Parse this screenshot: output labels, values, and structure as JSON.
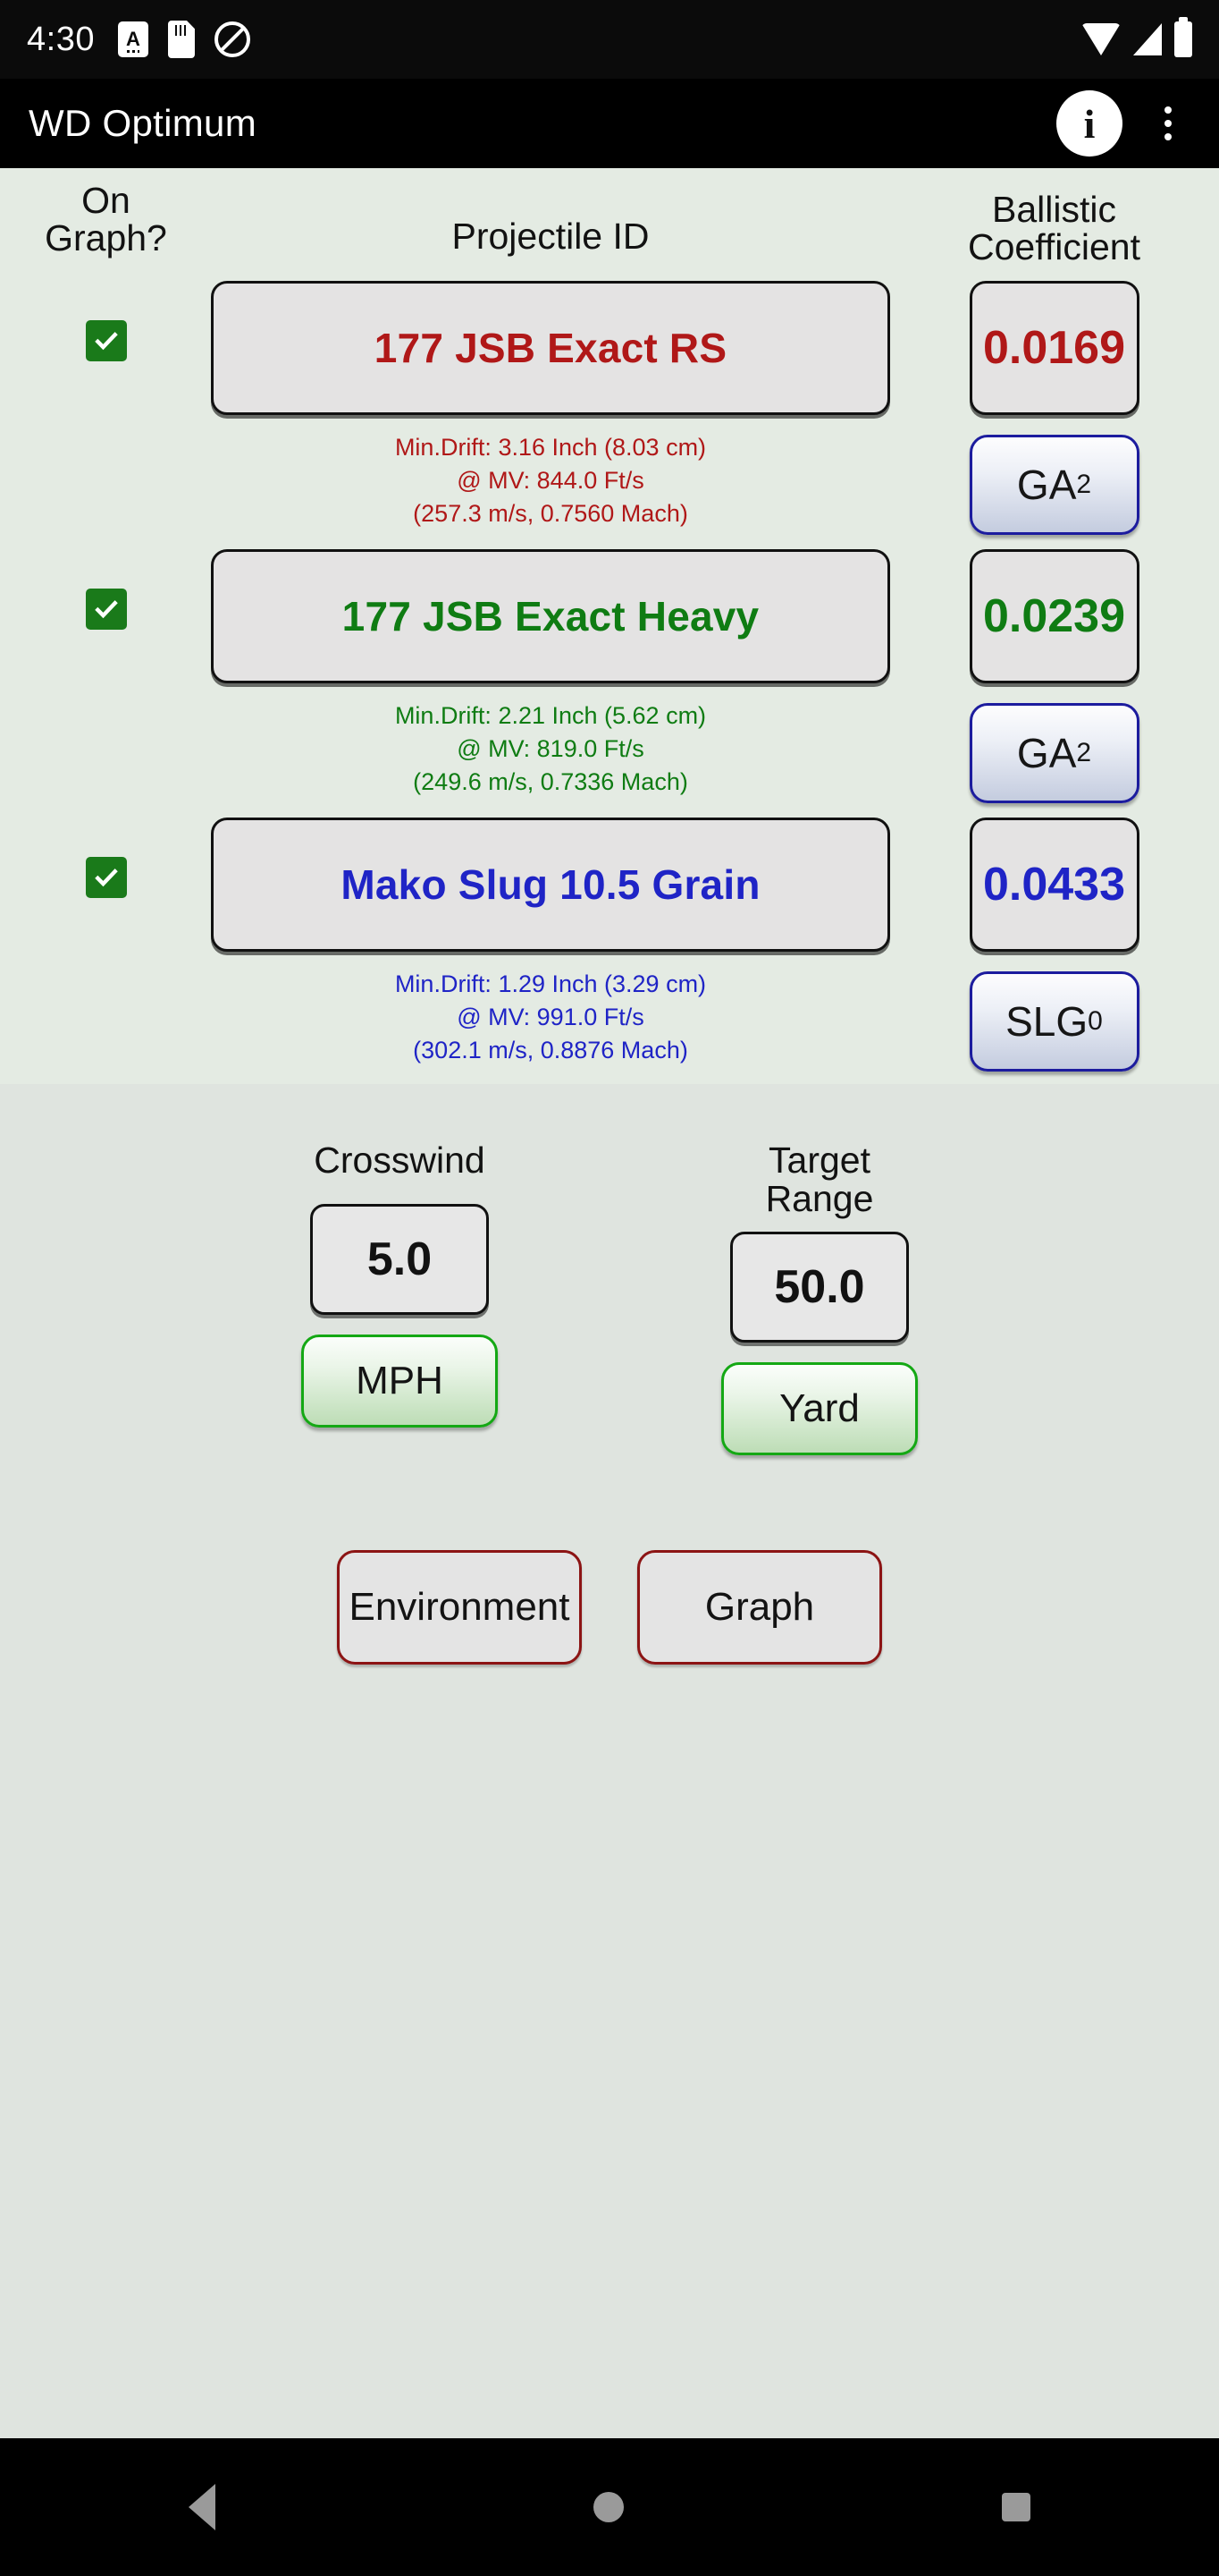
{
  "status_bar": {
    "clock": "4:30",
    "icons": [
      "abc-keyboard-icon",
      "sd-card-icon",
      "do-not-disturb-icon",
      "wifi-icon",
      "cell-signal-icon",
      "battery-icon"
    ]
  },
  "app_bar": {
    "title": "WD Optimum",
    "info_label": "i",
    "overflow_label": "more-options"
  },
  "table": {
    "headers": {
      "on_graph": "On\nGraph?",
      "on_graph_line1": "On",
      "on_graph_line2": "Graph?",
      "projectile_id": "Projectile ID",
      "ballistic_coefficient_line1": "Ballistic",
      "ballistic_coefficient_line2": "Coefficient"
    },
    "rows": [
      {
        "checked": true,
        "name": "177 JSB Exact RS",
        "bc": "0.0169",
        "drag_model": "GA",
        "drag_model_sub": "2",
        "detail_line1": "Min.Drift: 3.16 Inch (8.03 cm)",
        "detail_line2": "@ MV: 844.0 Ft/s",
        "detail_line3": "(257.3 m/s, 0.7560 Mach)",
        "color": "#b01818"
      },
      {
        "checked": true,
        "name": "177 JSB Exact Heavy",
        "bc": "0.0239",
        "drag_model": "GA",
        "drag_model_sub": "2",
        "detail_line1": "Min.Drift: 2.21 Inch (5.62 cm)",
        "detail_line2": "@ MV: 819.0 Ft/s",
        "detail_line3": "(249.6 m/s, 0.7336 Mach)",
        "color": "#0f7c13"
      },
      {
        "checked": true,
        "name": "Mako Slug 10.5 Grain",
        "bc": "0.0433",
        "drag_model": "SLG",
        "drag_model_sub": "0",
        "detail_line1": "Min.Drift: 1.29 Inch (3.29 cm)",
        "detail_line2": "@ MV: 991.0 Ft/s",
        "detail_line3": "(302.1 m/s, 0.8876 Mach)",
        "color": "#1f24c6"
      }
    ]
  },
  "inputs": {
    "crosswind": {
      "label_line1": "Crosswind",
      "label_line2": "",
      "value": "5.0",
      "unit": "MPH"
    },
    "target_range": {
      "label_line1": "Target",
      "label_line2": "Range",
      "value": "50.0",
      "unit": "Yard"
    }
  },
  "actions": {
    "environment": "Environment",
    "graph": "Graph"
  },
  "nav_bar": {
    "back": "back-button",
    "home": "home-button",
    "recents": "recents-button"
  },
  "colors": {
    "row1": "#b01818",
    "row2": "#0f7c13",
    "row3": "#1f24c6",
    "checkbox_green": "#1a7a1a",
    "drag_border": "#1c1c9e",
    "unit_border": "#14a814",
    "action_border": "#8c1414",
    "table_bg": "#e4ebe3",
    "lower_bg": "#dfe4df"
  }
}
